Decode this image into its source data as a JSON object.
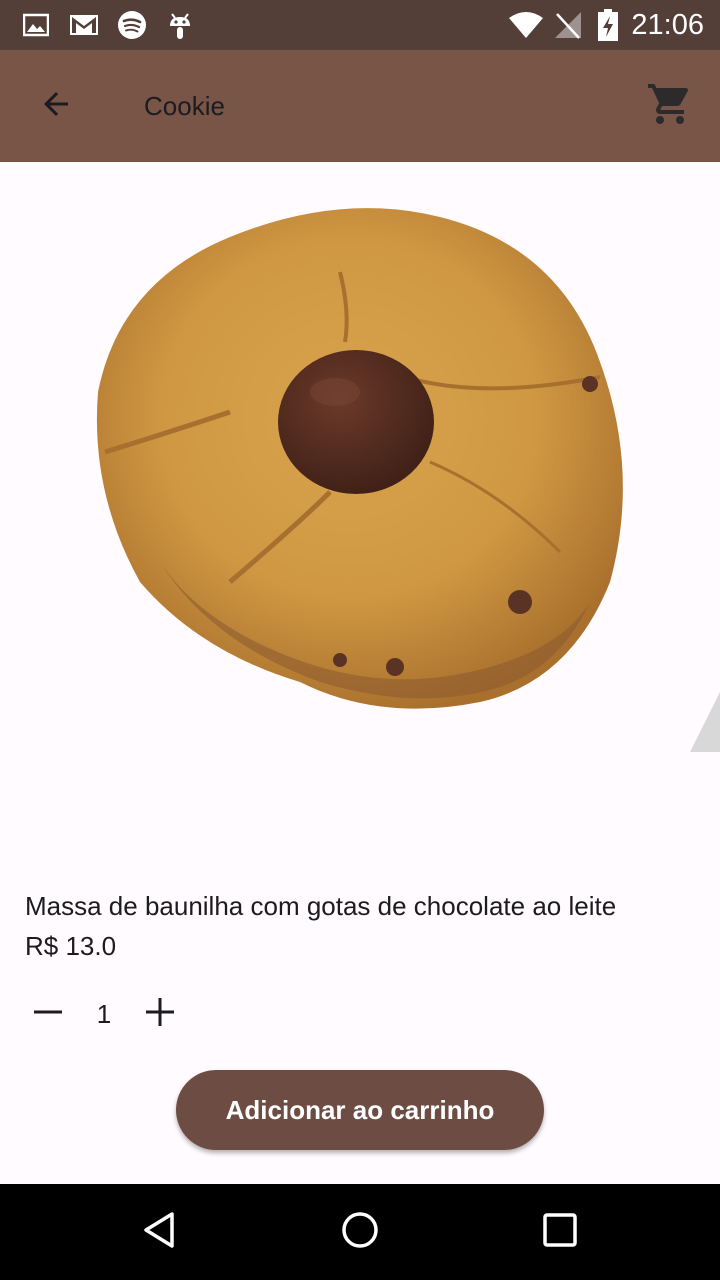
{
  "status_bar": {
    "time": "21:06",
    "icons": [
      "gallery-icon",
      "gmail-icon",
      "spotify-icon",
      "android-icon",
      "wifi-icon",
      "no-signal-icon",
      "battery-charging-icon"
    ]
  },
  "app_bar": {
    "title": "Cookie",
    "back_icon": "arrow-back-icon",
    "cart_icon": "shopping-cart-icon"
  },
  "product": {
    "description": "Massa de baunilha com gotas de chocolate ao leite",
    "price": "R$ 13.0",
    "image": "cookie-photo"
  },
  "quantity": {
    "value": "1",
    "minus_icon": "minus-icon",
    "plus_icon": "plus-icon"
  },
  "actions": {
    "add_to_cart_label": "Adicionar ao carrinho"
  },
  "nav_bar": {
    "icons": [
      "back-triangle-icon",
      "home-circle-icon",
      "recents-square-icon"
    ]
  },
  "colors": {
    "status_bar": "#533f38",
    "app_bar": "#795548",
    "button": "#6d4c44",
    "background": "#fffbfe"
  }
}
